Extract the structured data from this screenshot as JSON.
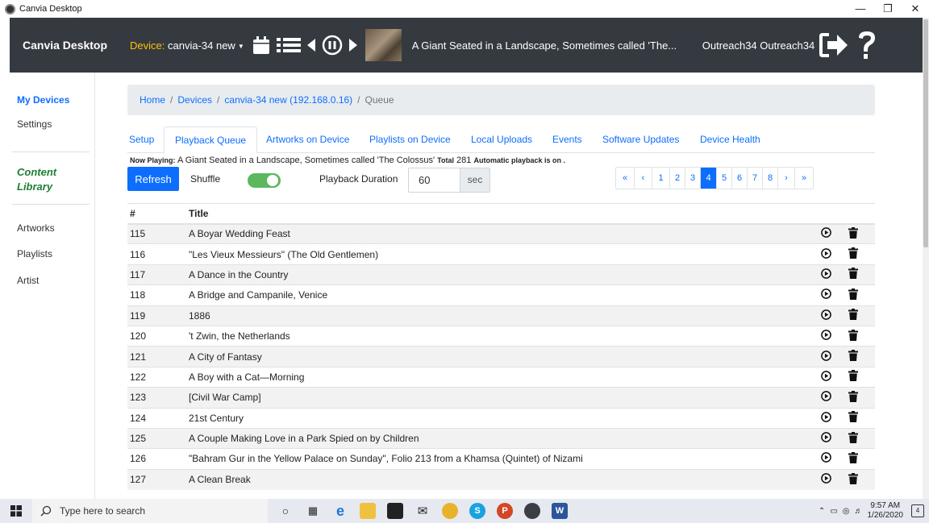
{
  "window": {
    "title": "Canvia Desktop"
  },
  "navbar": {
    "brand": "Canvia Desktop",
    "device_label": "Device:",
    "device_name": "canvia-34 new",
    "now_playing_title": "A Giant Seated in a Landscape, Sometimes called 'The...",
    "user": "Outreach34 Outreach34"
  },
  "sidebar": {
    "my_devices": "My Devices",
    "settings": "Settings",
    "content_library_1": "Content",
    "content_library_2": "Library",
    "artworks": "Artworks",
    "playlists": "Playlists",
    "artist": "Artist"
  },
  "breadcrumb": {
    "home": "Home",
    "devices": "Devices",
    "device": "canvia-34 new (192.168.0.16)",
    "current": "Queue",
    "sep": "/"
  },
  "tabs": [
    "Setup",
    "Playback Queue",
    "Artworks on Device",
    "Playlists on Device",
    "Local Uploads",
    "Events",
    "Software Updates",
    "Device Health"
  ],
  "status": {
    "now_playing_label": "Now Playing:",
    "now_playing": "A Giant Seated in a Landscape, Sometimes called 'The Colossus'",
    "total_label": "Total",
    "total": "281",
    "auto_text": "Automatic playback is on ."
  },
  "controls": {
    "refresh": "Refresh",
    "shuffle_label": "Shuffle",
    "shuffle_on": true,
    "duration_label": "Playback Duration",
    "duration_value": "60",
    "duration_unit": "sec"
  },
  "pagination": {
    "items": [
      "«",
      "‹",
      "1",
      "2",
      "3",
      "4",
      "5",
      "6",
      "7",
      "8",
      "›",
      "»"
    ],
    "active": "4"
  },
  "table": {
    "headers": [
      "#",
      "Title"
    ],
    "rows": [
      {
        "num": "115",
        "title": "A Boyar Wedding Feast"
      },
      {
        "num": "116",
        "title": "\"Les Vieux Messieurs\" (The Old Gentlemen)"
      },
      {
        "num": "117",
        "title": "A Dance in the Country"
      },
      {
        "num": "118",
        "title": "A Bridge and Campanile, Venice"
      },
      {
        "num": "119",
        "title": "1886"
      },
      {
        "num": "120",
        "title": "'t Zwin, the Netherlands"
      },
      {
        "num": "121",
        "title": "A City of Fantasy"
      },
      {
        "num": "122",
        "title": "A Boy with a Cat—Morning"
      },
      {
        "num": "123",
        "title": "[Civil War Camp]"
      },
      {
        "num": "124",
        "title": "21st Century"
      },
      {
        "num": "125",
        "title": "A Couple Making Love in a Park Spied on by Children"
      },
      {
        "num": "126",
        "title": "\"Bahram Gur in the Yellow Palace on Sunday\", Folio 213 from a Khamsa (Quintet) of Nizami"
      },
      {
        "num": "127",
        "title": "A Clean Break"
      }
    ]
  },
  "taskbar": {
    "search_placeholder": "Type here to search",
    "time": "9:57 AM",
    "date": "1/26/2020",
    "notif_count": "4"
  }
}
